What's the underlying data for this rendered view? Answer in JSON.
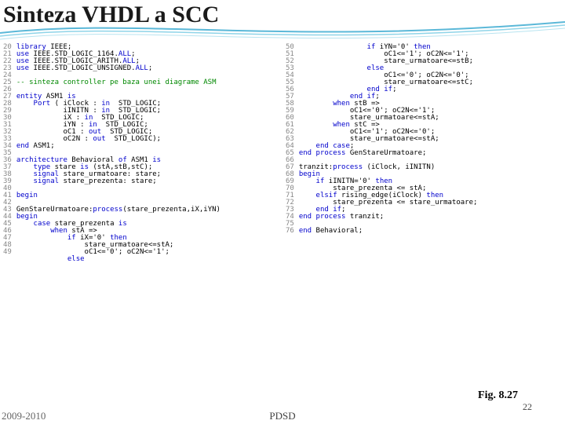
{
  "header": {
    "title": "Sinteza VHDL a SCC"
  },
  "figure": {
    "caption": "Fig. 8.27"
  },
  "footer": {
    "left": "2009-2010",
    "center": "PDSD",
    "right": "22"
  },
  "code": {
    "left": {
      "lines": "20\n21\n22\n23\n24\n25\n26\n27\n28\n29\n30\n31\n32\n33\n34\n35\n36\n37\n38\n39\n40\n41\n42\n43\n44\n45\n46\n47\n48\n49",
      "tokens": [
        [
          [
            "kw",
            "library"
          ],
          [
            "id",
            " IEEE;"
          ]
        ],
        [
          [
            "kw",
            "use"
          ],
          [
            "id",
            " IEEE.STD_LOGIC_1164."
          ],
          [
            "kw",
            "ALL"
          ],
          [
            "id",
            ";"
          ]
        ],
        [
          [
            "kw",
            "use"
          ],
          [
            "id",
            " IEEE.STD_LOGIC_ARITH."
          ],
          [
            "kw",
            "ALL"
          ],
          [
            "id",
            ";"
          ]
        ],
        [
          [
            "kw",
            "use"
          ],
          [
            "id",
            " IEEE.STD_LOGIC_UNSIGNED."
          ],
          [
            "kw",
            "ALL"
          ],
          [
            "id",
            ";"
          ]
        ],
        [],
        [
          [
            "cm",
            "-- sinteza controller pe baza unei diagrame ASM"
          ]
        ],
        [],
        [
          [
            "kw",
            "entity"
          ],
          [
            "id",
            " ASM1 "
          ],
          [
            "kw",
            "is"
          ]
        ],
        [
          [
            "id",
            "    "
          ],
          [
            "kw",
            "Port"
          ],
          [
            "id",
            " ( iClock : "
          ],
          [
            "kw",
            "in"
          ],
          [
            "id",
            "  STD_LOGIC;"
          ]
        ],
        [
          [
            "id",
            "           iINITN : "
          ],
          [
            "kw",
            "in"
          ],
          [
            "id",
            "  STD_LOGIC;"
          ]
        ],
        [
          [
            "id",
            "           iX : "
          ],
          [
            "kw",
            "in"
          ],
          [
            "id",
            "  STD_LOGIC;"
          ]
        ],
        [
          [
            "id",
            "           iYN : "
          ],
          [
            "kw",
            "in"
          ],
          [
            "id",
            "  STD_LOGIC;"
          ]
        ],
        [
          [
            "id",
            "           oC1 : "
          ],
          [
            "kw",
            "out"
          ],
          [
            "id",
            "  STD_LOGIC;"
          ]
        ],
        [
          [
            "id",
            "           oC2N : "
          ],
          [
            "kw",
            "out"
          ],
          [
            "id",
            "  STD_LOGIC);"
          ]
        ],
        [
          [
            "kw",
            "end"
          ],
          [
            "id",
            " ASM1;"
          ]
        ],
        [],
        [
          [
            "kw",
            "architecture"
          ],
          [
            "id",
            " Behavioral "
          ],
          [
            "kw",
            "of"
          ],
          [
            "id",
            " ASM1 "
          ],
          [
            "kw",
            "is"
          ]
        ],
        [
          [
            "id",
            "    "
          ],
          [
            "kw",
            "type"
          ],
          [
            "id",
            " stare "
          ],
          [
            "kw",
            "is"
          ],
          [
            "id",
            " (stA,stB,stC);"
          ]
        ],
        [
          [
            "id",
            "    "
          ],
          [
            "kw",
            "signal"
          ],
          [
            "id",
            " stare_urmatoare: stare;"
          ]
        ],
        [
          [
            "id",
            "    "
          ],
          [
            "kw",
            "signal"
          ],
          [
            "id",
            " stare_prezenta: stare;"
          ]
        ],
        [],
        [
          [
            "kw",
            "begin"
          ]
        ],
        [],
        [
          [
            "id",
            "GenStareUrmatoare:"
          ],
          [
            "kw",
            "process"
          ],
          [
            "id",
            "(stare_prezenta,iX,iYN)"
          ]
        ],
        [
          [
            "kw",
            "begin"
          ]
        ],
        [
          [
            "id",
            "    "
          ],
          [
            "kw",
            "case"
          ],
          [
            "id",
            " stare_prezenta "
          ],
          [
            "kw",
            "is"
          ]
        ],
        [
          [
            "id",
            "        "
          ],
          [
            "kw",
            "when"
          ],
          [
            "id",
            " stA =>"
          ]
        ],
        [
          [
            "id",
            "            "
          ],
          [
            "kw",
            "if"
          ],
          [
            "id",
            " iX='0' "
          ],
          [
            "kw",
            "then"
          ]
        ],
        [
          [
            "id",
            "                stare_urmatoare<=stA;"
          ]
        ],
        [
          [
            "id",
            "                oC1<='0'; oC2N<='1';"
          ]
        ],
        [
          [
            "id",
            "            "
          ],
          [
            "kw",
            "else"
          ]
        ]
      ]
    },
    "right": {
      "lines": "50\n51\n52\n53\n54\n55\n56\n57\n58\n59\n60\n61\n62\n63\n64\n65\n66\n67\n68\n69\n70\n71\n72\n73\n74\n75\n76",
      "tokens": [
        [
          [
            "id",
            "                "
          ],
          [
            "kw",
            "if"
          ],
          [
            "id",
            " iYN='0' "
          ],
          [
            "kw",
            "then"
          ]
        ],
        [
          [
            "id",
            "                    oC1<='1'; oC2N<='1';"
          ]
        ],
        [
          [
            "id",
            "                    stare_urmatoare<=stB;"
          ]
        ],
        [
          [
            "id",
            "                "
          ],
          [
            "kw",
            "else"
          ]
        ],
        [
          [
            "id",
            "                    oC1<='0'; oC2N<='0';"
          ]
        ],
        [
          [
            "id",
            "                    stare_urmatoare<=stC;"
          ]
        ],
        [
          [
            "id",
            "                "
          ],
          [
            "kw",
            "end if"
          ],
          [
            "id",
            ";"
          ]
        ],
        [
          [
            "id",
            "            "
          ],
          [
            "kw",
            "end if"
          ],
          [
            "id",
            ";"
          ]
        ],
        [
          [
            "id",
            "        "
          ],
          [
            "kw",
            "when"
          ],
          [
            "id",
            " stB =>"
          ]
        ],
        [
          [
            "id",
            "            oC1<='0'; oC2N<='1';"
          ]
        ],
        [
          [
            "id",
            "            stare_urmatoare<=stA;"
          ]
        ],
        [
          [
            "id",
            "        "
          ],
          [
            "kw",
            "when"
          ],
          [
            "id",
            " stC =>"
          ]
        ],
        [
          [
            "id",
            "            oC1<='1'; oC2N<='0';"
          ]
        ],
        [
          [
            "id",
            "            stare_urmatoare<=stA;"
          ]
        ],
        [
          [
            "id",
            "    "
          ],
          [
            "kw",
            "end case"
          ],
          [
            "id",
            ";"
          ]
        ],
        [
          [
            "kw",
            "end process"
          ],
          [
            "id",
            " GenStareUrmatoare;"
          ]
        ],
        [],
        [
          [
            "id",
            "tranzit:"
          ],
          [
            "kw",
            "process"
          ],
          [
            "id",
            " (iClock, iINITN)"
          ]
        ],
        [
          [
            "kw",
            "begin"
          ]
        ],
        [
          [
            "id",
            "    "
          ],
          [
            "kw",
            "if"
          ],
          [
            "id",
            " iINITN='0' "
          ],
          [
            "kw",
            "then"
          ]
        ],
        [
          [
            "id",
            "        stare_prezenta <= stA;"
          ]
        ],
        [
          [
            "id",
            "    "
          ],
          [
            "kw",
            "elsif"
          ],
          [
            "id",
            " rising_edge(iClock) "
          ],
          [
            "kw",
            "then"
          ]
        ],
        [
          [
            "id",
            "        stare_prezenta <= stare_urmatoare;"
          ]
        ],
        [
          [
            "id",
            "    "
          ],
          [
            "kw",
            "end if"
          ],
          [
            "id",
            ";"
          ]
        ],
        [
          [
            "kw",
            "end process"
          ],
          [
            "id",
            " tranzit;"
          ]
        ],
        [],
        [
          [
            "kw",
            "end"
          ],
          [
            "id",
            " Behavioral;"
          ]
        ]
      ]
    }
  }
}
